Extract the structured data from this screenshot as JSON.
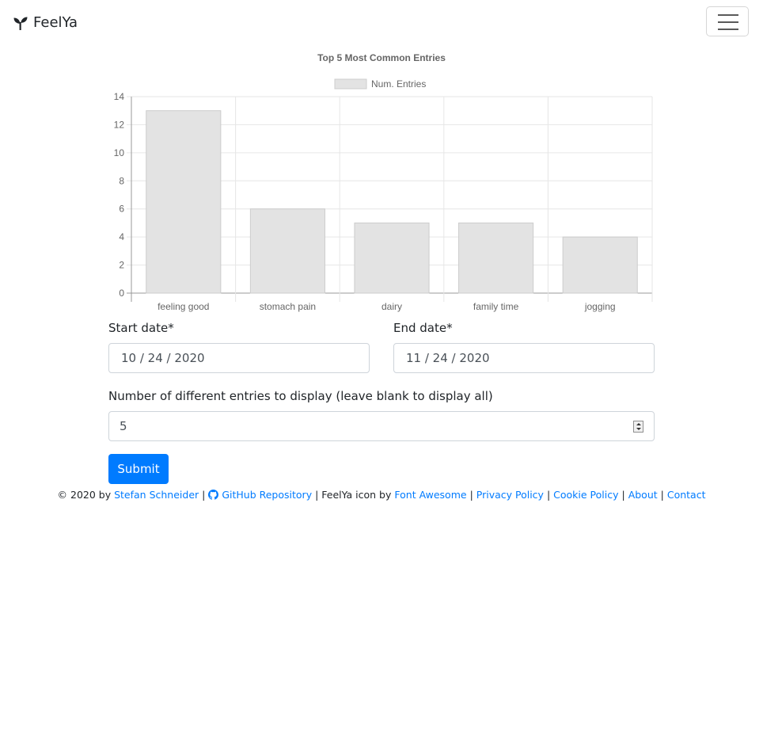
{
  "navbar": {
    "brand": "FeelYa",
    "brand_icon": "seedling-icon",
    "toggler_icon": "hamburger-menu-icon"
  },
  "chart_data": {
    "type": "bar",
    "title": "Top 5 Most Common Entries",
    "categories": [
      "feeling good",
      "stomach pain",
      "dairy",
      "family time",
      "jogging"
    ],
    "series": [
      {
        "name": "Num. Entries",
        "values": [
          13,
          6,
          5,
          5,
          4
        ]
      }
    ],
    "ylim": [
      0,
      14
    ],
    "yticks": [
      0,
      2,
      4,
      6,
      8,
      10,
      12,
      14
    ],
    "xlabel": "",
    "ylabel": "",
    "grid": true,
    "legend": "top",
    "bar_color": "#e3e3e3",
    "bar_border": "#cccccc"
  },
  "form": {
    "start_label": "Start date*",
    "start_value": "10 / 24 / 2020",
    "end_label": "End date*",
    "end_value": "11 / 24 / 2020",
    "count_label": "Number of different entries to display (leave blank to display all)",
    "count_value": "5",
    "submit_label": "Submit"
  },
  "footer": {
    "prefix": "© 2020 by",
    "author": "Stefan Schneider",
    "sep": "|",
    "repo": "GitHub Repository",
    "icon_text": "| FeelYa icon by",
    "font_awesome": "Font Awesome",
    "privacy": "Privacy Policy",
    "cookie": "Cookie Policy",
    "about": "About",
    "contact": "Contact"
  },
  "colors": {
    "link": "#007bff",
    "button": "#007bff"
  }
}
